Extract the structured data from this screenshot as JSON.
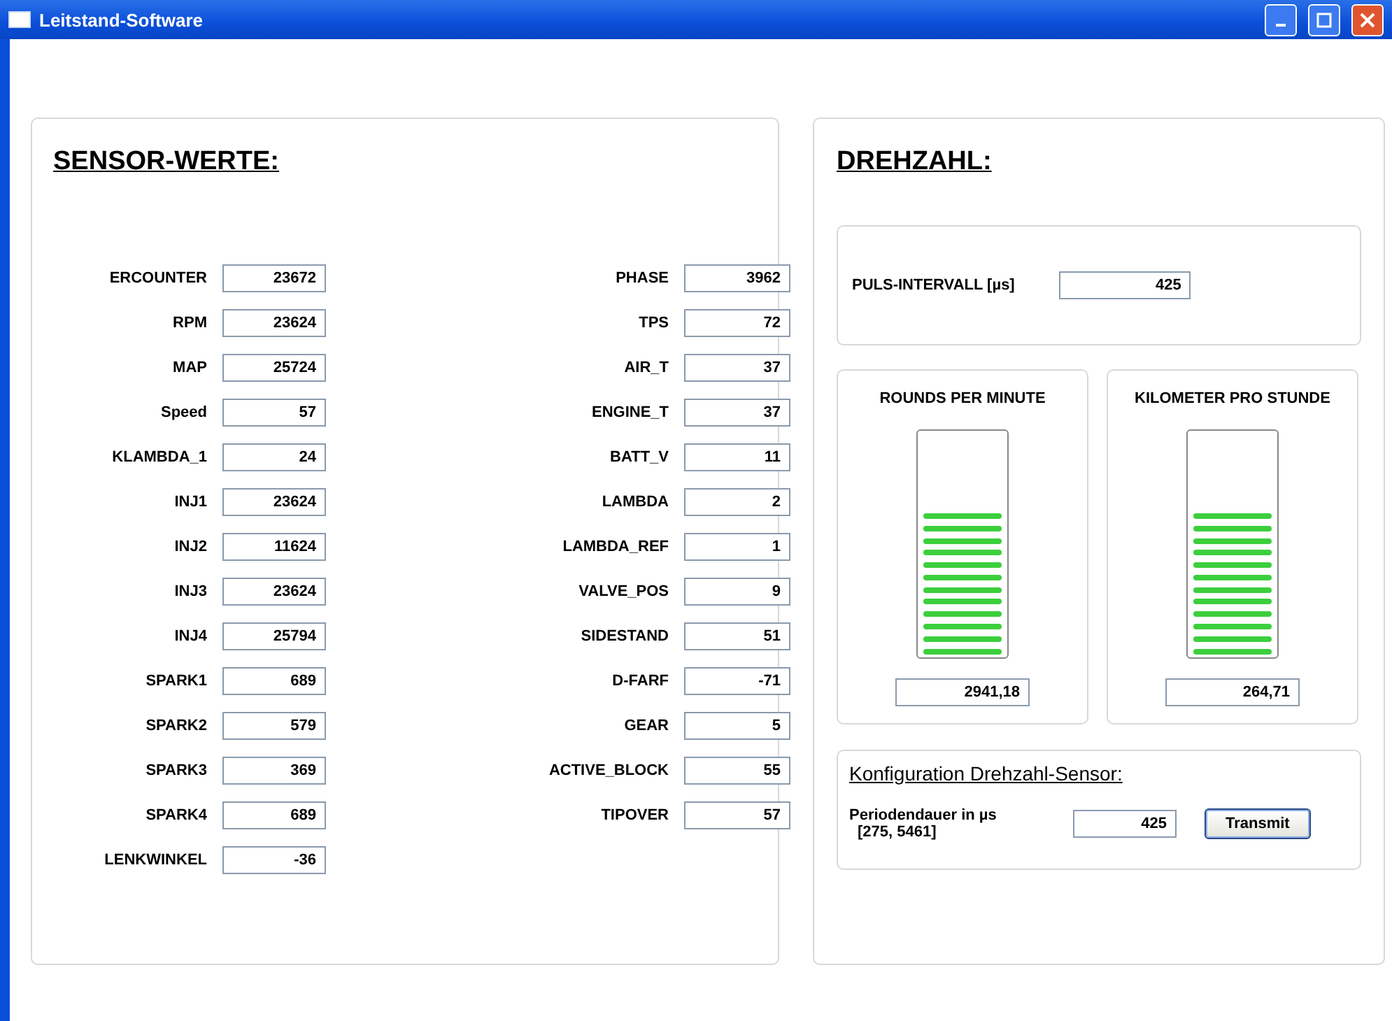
{
  "window": {
    "title": "Leitstand-Software"
  },
  "sensor_panel": {
    "title": "SENSOR-WERTE:",
    "columns": [
      [
        {
          "label": "ERCOUNTER",
          "value": "23672"
        },
        {
          "label": "RPM",
          "value": "23624"
        },
        {
          "label": "MAP",
          "value": "25724"
        },
        {
          "label": "Speed",
          "value": "57"
        },
        {
          "label": "KLAMBDA_1",
          "value": "24"
        },
        {
          "label": "INJ1",
          "value": "23624"
        },
        {
          "label": "INJ2",
          "value": "11624"
        },
        {
          "label": "INJ3",
          "value": "23624"
        },
        {
          "label": "INJ4",
          "value": "25794"
        },
        {
          "label": "SPARK1",
          "value": "689"
        },
        {
          "label": "SPARK2",
          "value": "579"
        },
        {
          "label": "SPARK3",
          "value": "369"
        },
        {
          "label": "SPARK4",
          "value": "689"
        },
        {
          "label": "LENKWINKEL",
          "value": "-36"
        }
      ],
      [
        {
          "label": "PHASE",
          "value": "3962"
        },
        {
          "label": "TPS",
          "value": "72"
        },
        {
          "label": "AIR_T",
          "value": "37"
        },
        {
          "label": "ENGINE_T",
          "value": "37"
        },
        {
          "label": "BATT_V",
          "value": "11"
        },
        {
          "label": "LAMBDA",
          "value": "2"
        },
        {
          "label": "LAMBDA_REF",
          "value": "1"
        },
        {
          "label": "VALVE_POS",
          "value": "9"
        },
        {
          "label": "SIDESTAND",
          "value": "51"
        },
        {
          "label": "D-FARF",
          "value": "-71"
        },
        {
          "label": "GEAR",
          "value": "5"
        },
        {
          "label": "ACTIVE_BLOCK",
          "value": "55"
        },
        {
          "label": "TIPOVER",
          "value": "57"
        }
      ]
    ]
  },
  "speed_panel": {
    "title": "DREHZAHL:",
    "pulse": {
      "label": "PULS-INTERVALL [µs]",
      "value": "425"
    },
    "meters": [
      {
        "title": "ROUNDS PER MINUTE",
        "value": "2941,18"
      },
      {
        "title": "KILOMETER PRO STUNDE",
        "value": "264,71"
      }
    ],
    "config": {
      "title": "Konfiguration Drehzahl-Sensor:",
      "label": "Periodendauer in µs",
      "range": "[275, 5461]",
      "value": "425",
      "button": "Transmit"
    }
  }
}
